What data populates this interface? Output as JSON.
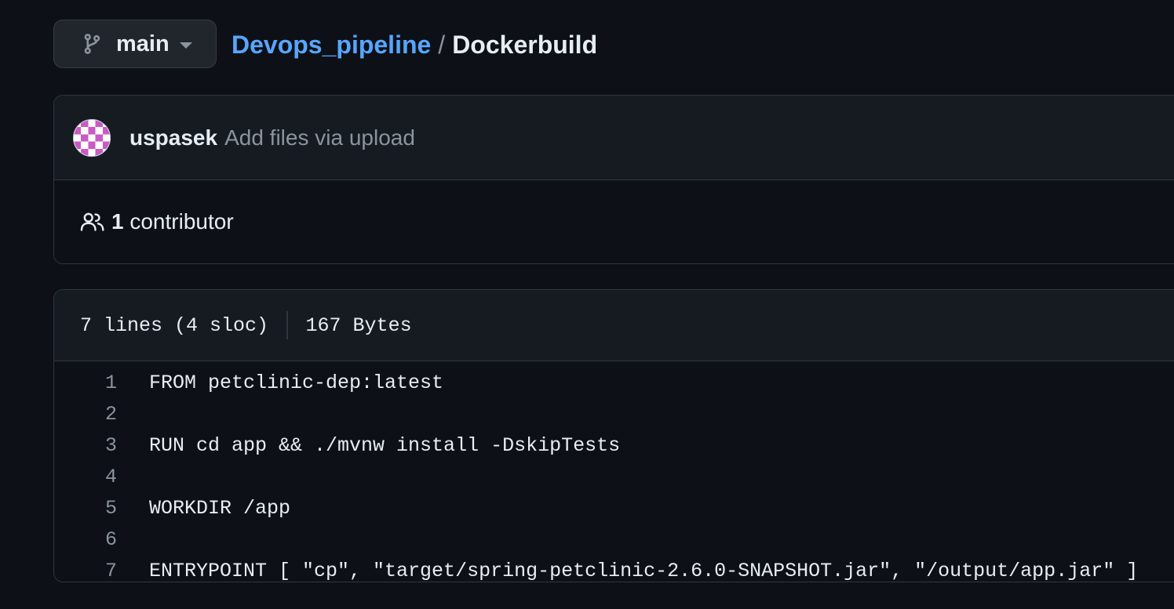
{
  "branch": {
    "name": "main",
    "icon": "git-branch-icon"
  },
  "breadcrumb": {
    "repo": "Devops_pipeline",
    "separator": "/",
    "file": "Dockerbuild"
  },
  "commit": {
    "author": "uspasek",
    "message": "Add files via upload",
    "avatar_colors": [
      "#c95bc2",
      "#ffffff"
    ]
  },
  "contributors": {
    "icon": "people-icon",
    "count": "1",
    "label": "contributor"
  },
  "file_info": {
    "lines": "7 lines (4 sloc)",
    "size": "167 Bytes"
  },
  "code": {
    "lines": [
      {
        "num": "1",
        "text": "FROM petclinic-dep:latest"
      },
      {
        "num": "2",
        "text": ""
      },
      {
        "num": "3",
        "text": "RUN cd app && ./mvnw install -DskipTests"
      },
      {
        "num": "4",
        "text": ""
      },
      {
        "num": "5",
        "text": "WORKDIR /app"
      },
      {
        "num": "6",
        "text": ""
      },
      {
        "num": "7",
        "text": "ENTRYPOINT [ \"cp\", \"target/spring-petclinic-2.6.0-SNAPSHOT.jar\", \"/output/app.jar\" ]"
      }
    ]
  },
  "colors": {
    "background": "#0d1117",
    "header_bg": "#161b22",
    "border": "#30363d",
    "link": "#58a6ff",
    "text": "#e6edf3",
    "muted": "#8b949e"
  }
}
